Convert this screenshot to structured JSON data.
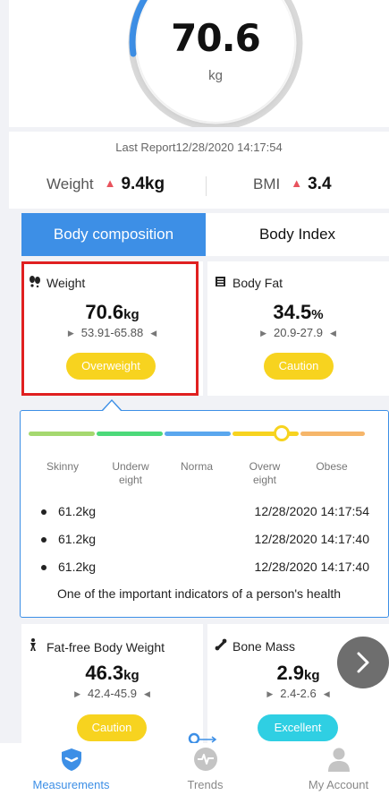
{
  "gauge": {
    "value": "70.6",
    "unit": "kg"
  },
  "report": {
    "time": "Last Report12/28/2020 14:17:54",
    "weight_label": "Weight",
    "weight_change": "9.4kg",
    "bmi_label": "BMI",
    "bmi_change": "3.4",
    "change_color": "#e8535d"
  },
  "tabs": {
    "active": "Body composition",
    "inactive": "Body Index"
  },
  "metrics": {
    "weight": {
      "title": "Weight",
      "value": "70.6",
      "unit": "kg",
      "range": "53.91-65.88",
      "status": "Overweight"
    },
    "body_fat": {
      "title": "Body Fat",
      "value": "34.5",
      "unit": "%",
      "range": "20.9-27.9",
      "status": "Caution"
    },
    "fat_free": {
      "title": "Fat-free Body Weight",
      "value": "46.3",
      "unit": "kg",
      "range": "42.4-45.9",
      "status": "Caution"
    },
    "bone_mass": {
      "title": "Bone Mass",
      "value": "2.9",
      "unit": "kg",
      "range": "2.4-2.6",
      "status": "Excellent"
    }
  },
  "scale": {
    "labels": [
      "Skinny",
      "Underw\neight",
      "Norma",
      "Overw\neight",
      "Obese"
    ],
    "colors": [
      "#a5d86f",
      "#4cd97a",
      "#5aa7ee",
      "#f7d31f",
      "#f6b66a"
    ]
  },
  "history": [
    {
      "weight": "61.2kg",
      "time": "12/28/2020 14:17:54"
    },
    {
      "weight": "61.2kg",
      "time": "12/28/2020 14:17:40"
    },
    {
      "weight": "61.2kg",
      "time": "12/28/2020 14:17:40"
    }
  ],
  "detail_description": "One of the important indicators of a person's health",
  "nav": {
    "measurements": "Measurements",
    "trends": "Trends",
    "account": "My Account"
  },
  "colors": {
    "accent": "#3d8fe6",
    "caution": "#f7d31f",
    "excellent": "#2fcfe3",
    "highlight": "#e02020"
  }
}
